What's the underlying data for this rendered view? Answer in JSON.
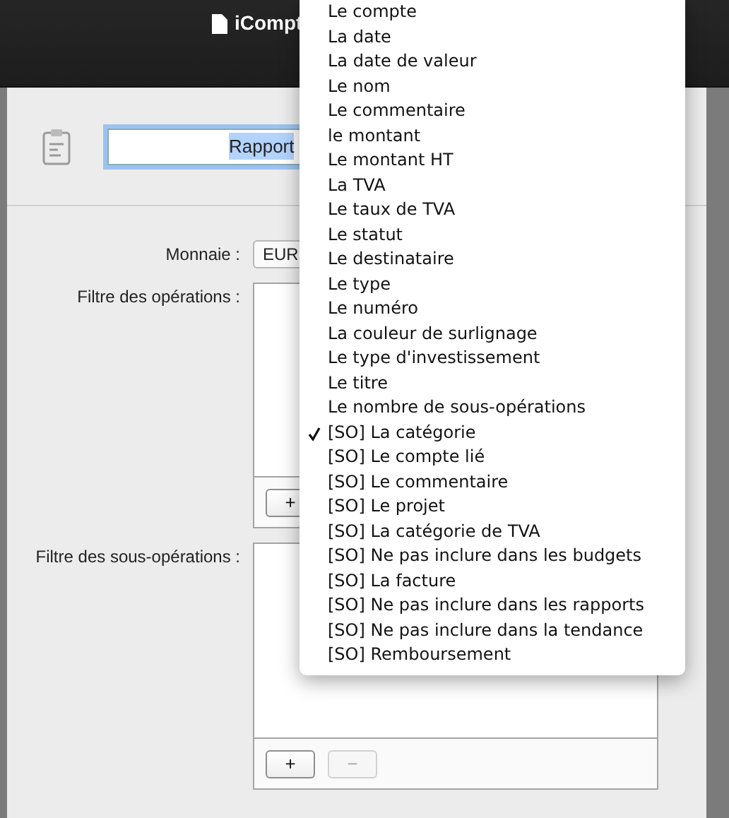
{
  "window": {
    "title": "iCompt"
  },
  "report": {
    "name": "Rapport",
    "selected": true
  },
  "currency": {
    "label": "Monnaie :",
    "value": "EUR"
  },
  "operations_filter": {
    "label": "Filtre des opérations :",
    "buttons": [
      {
        "label": "+",
        "disabled": false
      }
    ]
  },
  "suboperations_filter": {
    "label": "Filtre des sous-opérations :",
    "buttons": [
      {
        "label": "+",
        "disabled": false
      },
      {
        "label": "−",
        "disabled": true
      }
    ]
  },
  "menu": {
    "items": [
      {
        "label": "Le compte",
        "selected": false
      },
      {
        "label": "La date",
        "selected": false
      },
      {
        "label": "La date de valeur",
        "selected": false
      },
      {
        "label": "Le nom",
        "selected": false
      },
      {
        "label": "Le commentaire",
        "selected": false
      },
      {
        "label": "le montant",
        "selected": false
      },
      {
        "label": "Le montant HT",
        "selected": false
      },
      {
        "label": "La TVA",
        "selected": false
      },
      {
        "label": "Le taux de TVA",
        "selected": false
      },
      {
        "label": "Le statut",
        "selected": false
      },
      {
        "label": "Le destinataire",
        "selected": false
      },
      {
        "label": "Le type",
        "selected": false
      },
      {
        "label": "Le numéro",
        "selected": false
      },
      {
        "label": "La couleur de surlignage",
        "selected": false
      },
      {
        "label": "Le type d'investissement",
        "selected": false
      },
      {
        "label": "Le titre",
        "selected": false
      },
      {
        "label": "Le nombre de sous-opérations",
        "selected": false
      },
      {
        "label": "[SO] La catégorie",
        "selected": true
      },
      {
        "label": "[SO] Le compte lié",
        "selected": false
      },
      {
        "label": "[SO] Le commentaire",
        "selected": false
      },
      {
        "label": "[SO] Le projet",
        "selected": false
      },
      {
        "label": "[SO] La catégorie de TVA",
        "selected": false
      },
      {
        "label": "[SO] Ne pas inclure dans les budgets",
        "selected": false
      },
      {
        "label": "[SO] La facture",
        "selected": false
      },
      {
        "label": "[SO] Ne pas inclure dans les rapports",
        "selected": false
      },
      {
        "label": "[SO] Ne pas inclure dans la tendance",
        "selected": false
      },
      {
        "label": "[SO] Remboursement",
        "selected": false
      }
    ]
  }
}
